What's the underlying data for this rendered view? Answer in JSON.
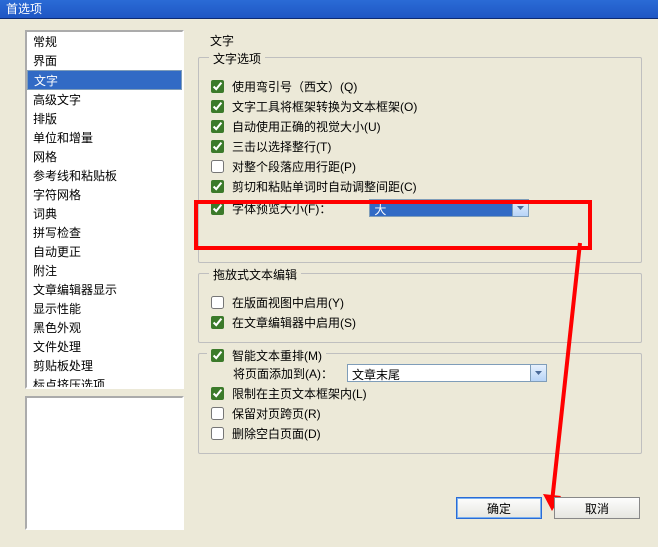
{
  "window": {
    "title": "首选项"
  },
  "sidebar": {
    "items": [
      "常规",
      "界面",
      "文字",
      "高级文字",
      "排版",
      "单位和增量",
      "网格",
      "参考线和粘贴板",
      "字符网格",
      "词典",
      "拼写检查",
      "自动更正",
      "附注",
      "文章编辑器显示",
      "显示性能",
      "黑色外观",
      "文件处理",
      "剪贴板处理",
      "标点挤压选项"
    ],
    "selected_index": 2
  },
  "panel": {
    "heading": "文字",
    "group_options": {
      "legend": "文字选项",
      "items": [
        {
          "id": "quotes",
          "checked": true,
          "label": "使用弯引号（西文）(Q)"
        },
        {
          "id": "convframe",
          "checked": true,
          "label": "文字工具将框架转换为文本框架(O)"
        },
        {
          "id": "visualsize",
          "checked": true,
          "label": "自动使用正确的视觉大小(U)"
        },
        {
          "id": "triple",
          "checked": true,
          "label": "三击以选择整行(T)"
        },
        {
          "id": "paraspace",
          "checked": false,
          "label": "对整个段落应用行距(P)"
        },
        {
          "id": "cutspace",
          "checked": true,
          "label": "剪切和粘贴单词时自动调整间距(C)"
        }
      ],
      "font_preview": {
        "checked": true,
        "label": "字体预览大小(F)：",
        "value": "大"
      }
    },
    "group_drag": {
      "legend": "拖放式文本编辑",
      "items": [
        {
          "id": "layoutview",
          "checked": false,
          "label": "在版面视图中启用(Y)"
        },
        {
          "id": "storyedit",
          "checked": true,
          "label": "在文章编辑器中启用(S)"
        }
      ]
    },
    "group_reflow": {
      "legend": "",
      "master": {
        "checked": true,
        "label": "智能文本重排(M)"
      },
      "addpages": {
        "label": "将页面添加到(A)：",
        "value": "文章末尾"
      },
      "sub": [
        {
          "id": "limitmaster",
          "checked": true,
          "label": "限制在主页文本框架内(L)"
        },
        {
          "id": "facing",
          "checked": false,
          "label": "保留对页跨页(R)"
        },
        {
          "id": "delblank",
          "checked": false,
          "label": "删除空白页面(D)"
        }
      ]
    }
  },
  "buttons": {
    "ok": "确定",
    "cancel": "取消"
  }
}
